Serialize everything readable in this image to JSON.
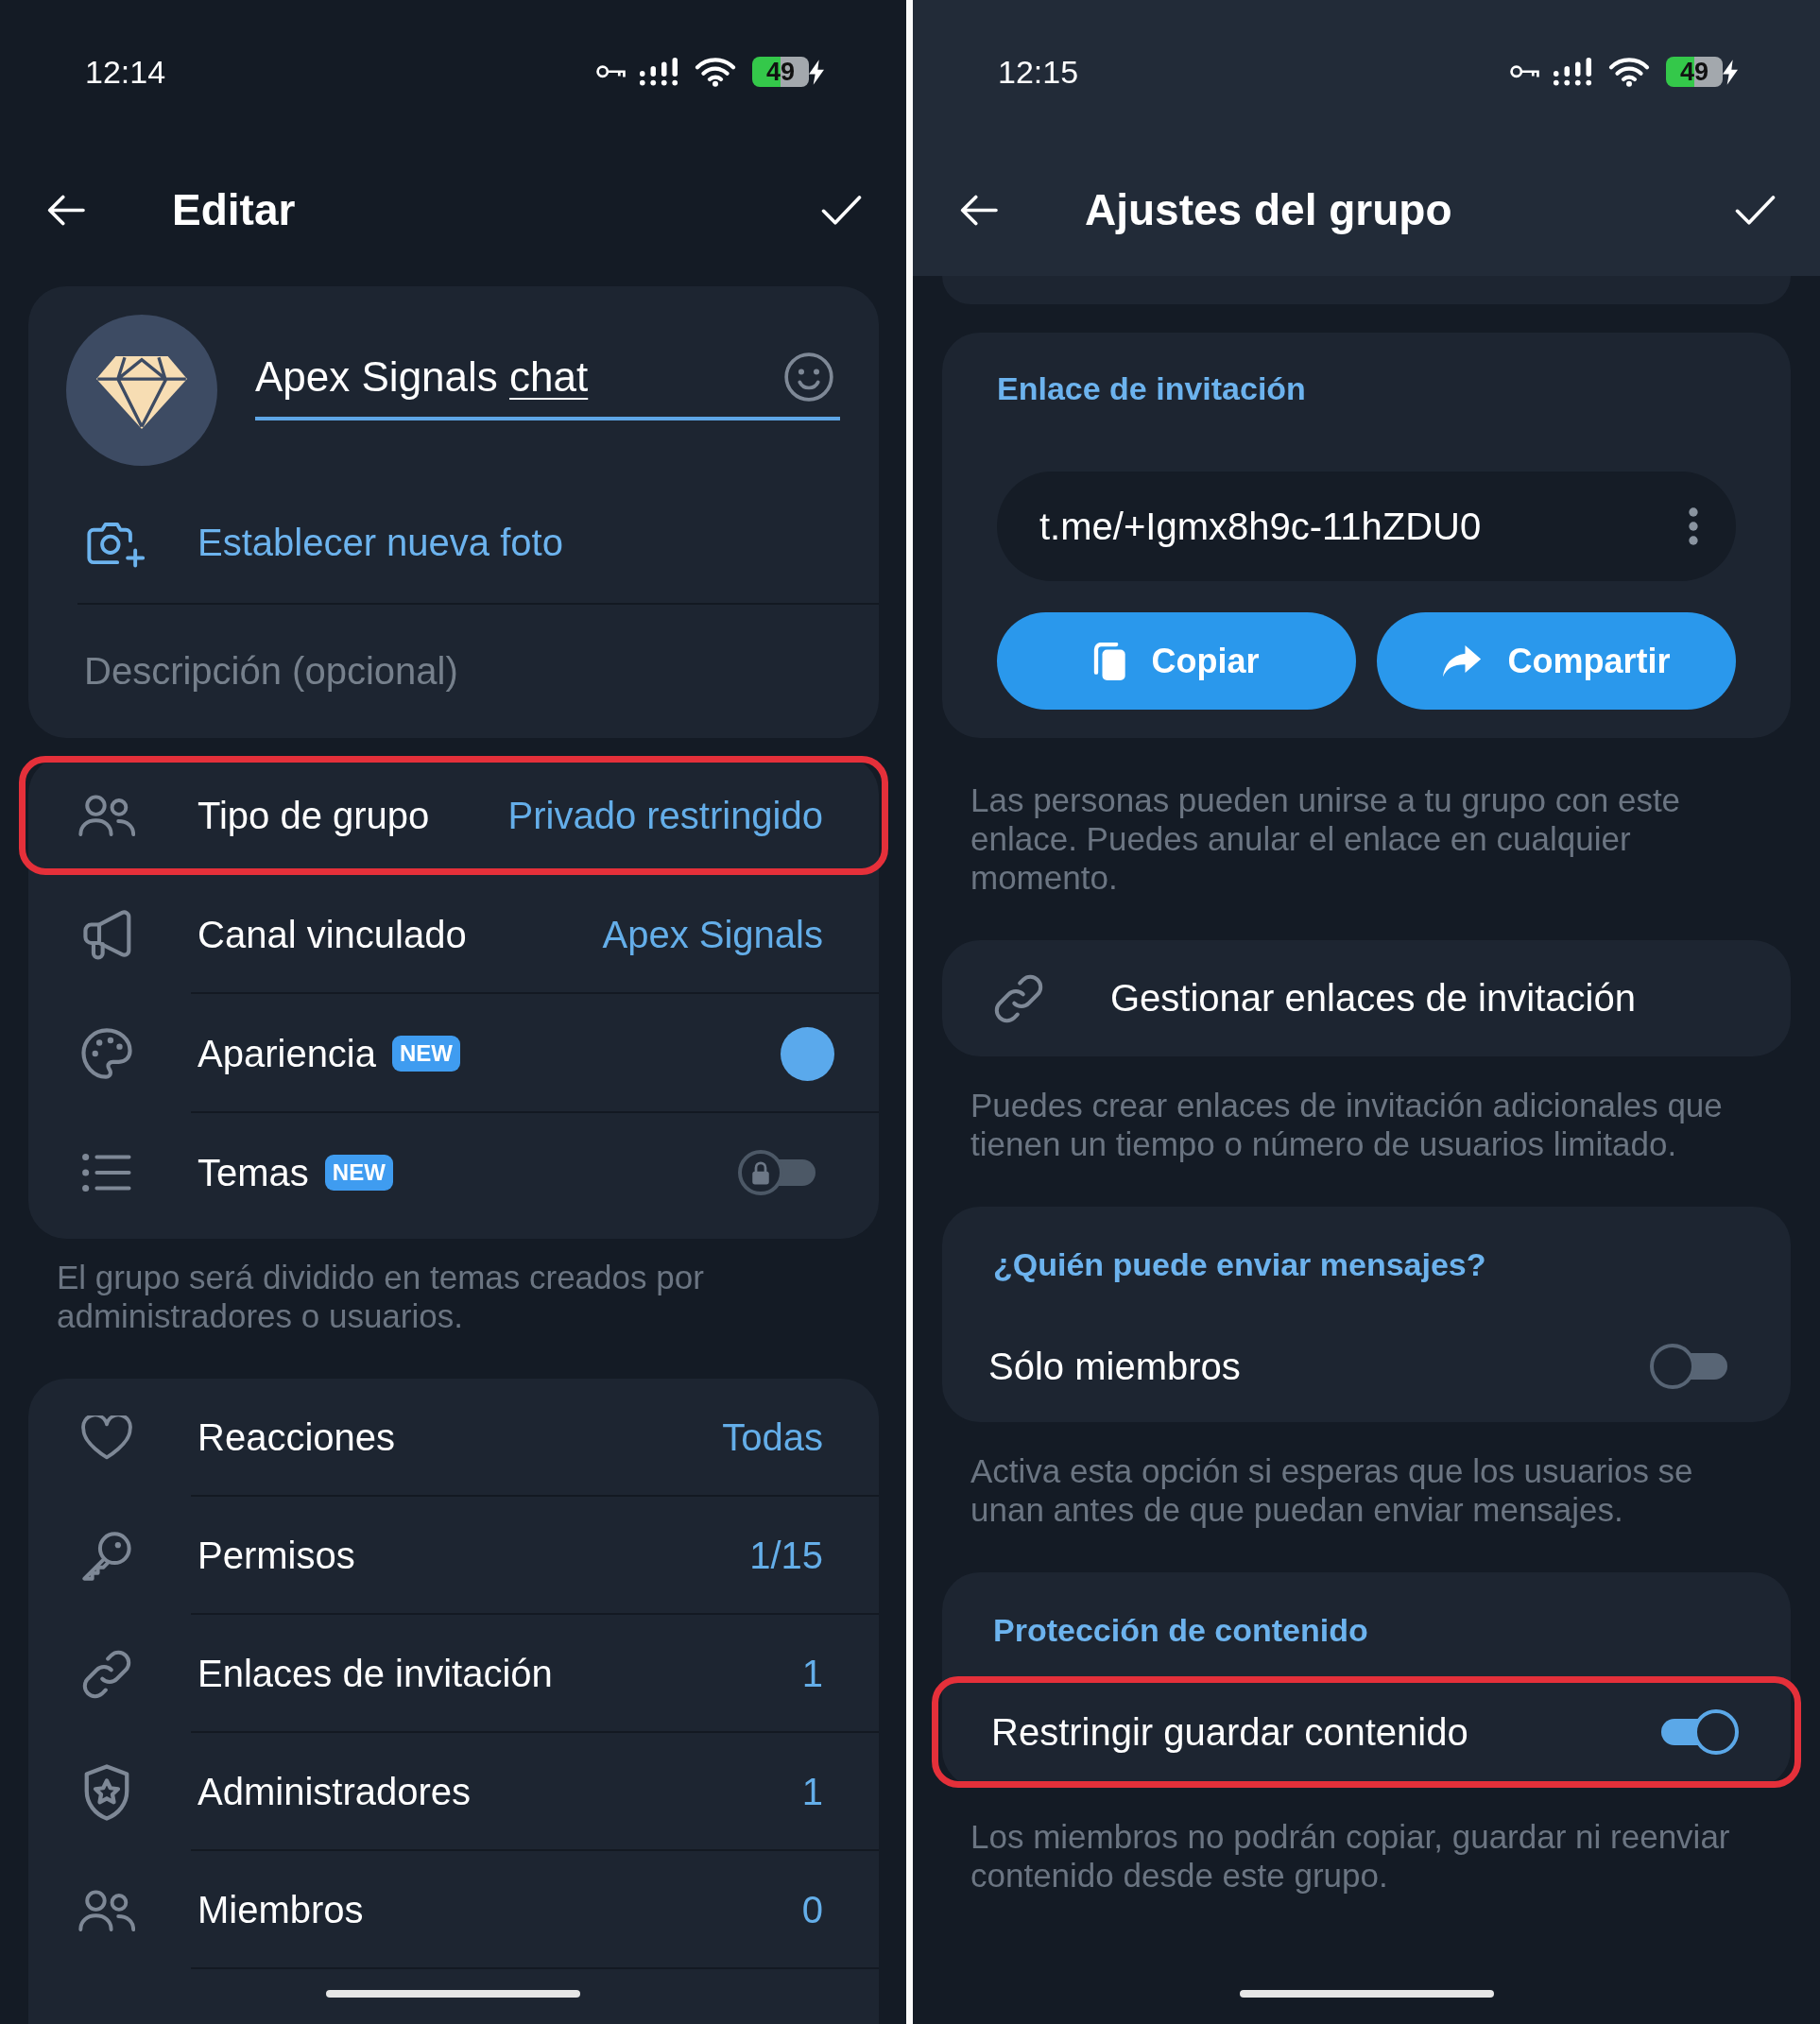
{
  "edit_screen": {
    "status_bar": {
      "time": "12:14",
      "battery": "49"
    },
    "toolbar": {
      "title": "Editar"
    },
    "profile_card": {
      "name_field": {
        "focused": true,
        "segments": [
          {
            "text": "Apex Signals",
            "underlined": false
          },
          {
            "text": "chat",
            "underlined": true
          }
        ]
      },
      "photo_action": "Establecer nueva foto",
      "description_field": {
        "placeholder": "Descripción (opcional)"
      }
    },
    "group_settings": {
      "items": [
        {
          "kind": "value",
          "label": "Tipo de grupo",
          "value": "Privado restringido",
          "highlighted": true
        },
        {
          "kind": "value",
          "label": "Canal vinculado",
          "value": "Apex Signals",
          "highlighted": false
        },
        {
          "kind": "color",
          "label": "Apariencia",
          "badge": "NEW",
          "color": "#5aa9ec",
          "highlighted": false
        },
        {
          "kind": "toggle",
          "label": "Temas",
          "badge": "NEW",
          "on": false,
          "locked": true,
          "highlighted": false
        }
      ],
      "footer": "El grupo será dividido en temas creados por administradores o usuarios."
    },
    "management": {
      "items": [
        {
          "kind": "value",
          "label": "Reacciones",
          "value": "Todas",
          "highlighted": false
        },
        {
          "kind": "value",
          "label": "Permisos",
          "value": "1/15",
          "highlighted": false
        },
        {
          "kind": "value",
          "label": "Enlaces de invitación",
          "value": "1",
          "highlighted": false
        },
        {
          "kind": "value",
          "label": "Administradores",
          "value": "1",
          "highlighted": false
        },
        {
          "kind": "value",
          "label": "Miembros",
          "value": "0",
          "highlighted": false
        }
      ]
    }
  },
  "settings_screen": {
    "status_bar": {
      "time": "12:15",
      "battery": "49"
    },
    "toolbar": {
      "title": "Ajustes del grupo"
    },
    "invite_link": {
      "header": "Enlace de invitación",
      "link": "t.me/+Igmx8h9c-11hZDU0",
      "buttons": [
        "Copiar",
        "Compartir"
      ],
      "footer": "Las personas pueden unirse a tu grupo con este enlace. Puedes anular el enlace en cualquier momento."
    },
    "manage_links": {
      "label": "Gestionar enlaces de invitación",
      "footer": "Puedes crear enlaces de invitación adicionales que tienen un tiempo o número de usuarios limitado."
    },
    "toggle_sections": [
      {
        "header": "¿Quién puede enviar mensajes?",
        "items": [
          {
            "kind": "toggle",
            "label": "Sólo miembros",
            "on": false,
            "highlighted": false
          }
        ],
        "footer": "Activa esta opción si esperas que los usuarios se unan antes de que puedan enviar mensajes."
      },
      {
        "header": "Protección de contenido",
        "items": [
          {
            "kind": "toggle",
            "label": "Restringir guardar contenido",
            "on": true,
            "highlighted": true
          }
        ],
        "footer": "Los miembros no podrán copiar, guardar ni reenviar contenido desde este grupo."
      }
    ]
  }
}
